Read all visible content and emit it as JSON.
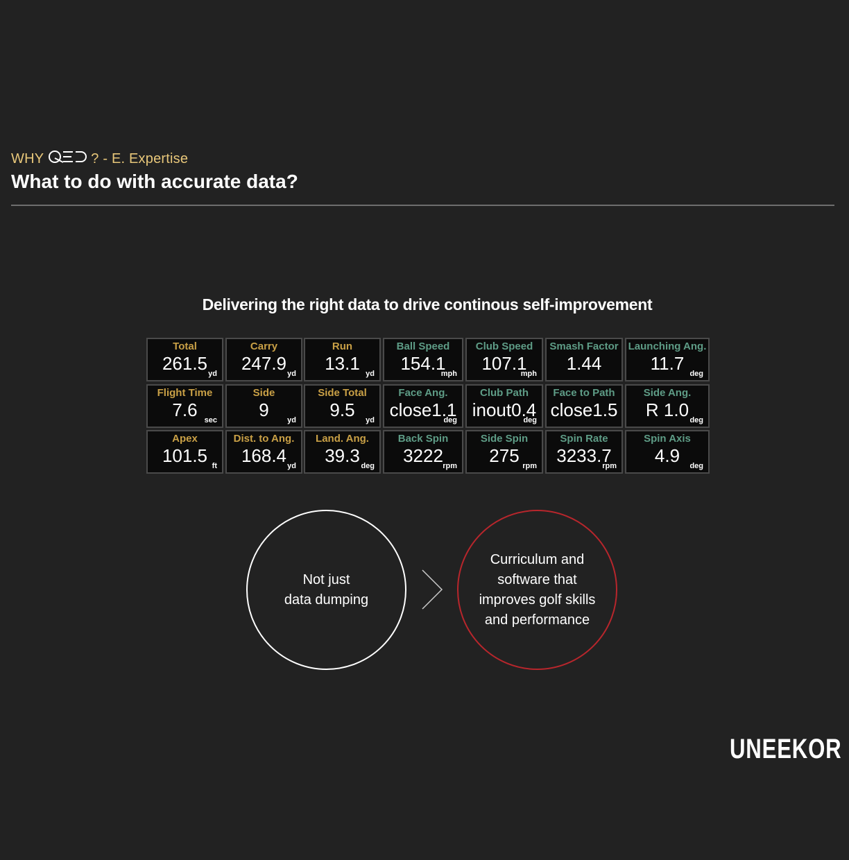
{
  "header": {
    "subtitle_prefix": "WHY",
    "subtitle_logo": "qed-logo",
    "subtitle_suffix": "? - E. Expertise",
    "title": "What to do with accurate data?"
  },
  "tagline": "Delivering the right data to drive continous self-improvement",
  "colors": {
    "background": "#222222",
    "gold_label": "#c9a046",
    "teal_label": "#5e9c86",
    "accent_red": "#b8262c"
  },
  "metrics": [
    [
      {
        "label": "Total",
        "value": "261.5",
        "unit": "yd",
        "color": "gold"
      },
      {
        "label": "Carry",
        "value": "247.9",
        "unit": "yd",
        "color": "gold"
      },
      {
        "label": "Run",
        "value": "13.1",
        "unit": "yd",
        "color": "gold"
      },
      {
        "label": "Ball Speed",
        "value": "154.1",
        "unit": "mph",
        "color": "teal"
      },
      {
        "label": "Club Speed",
        "value": "107.1",
        "unit": "mph",
        "color": "teal"
      },
      {
        "label": "Smash Factor",
        "value": "1.44",
        "unit": "",
        "color": "teal"
      },
      {
        "label": "Launching Ang.",
        "value": "11.7",
        "unit": "deg",
        "color": "teal"
      }
    ],
    [
      {
        "label": "Flight Time",
        "value": "7.6",
        "unit": "sec",
        "color": "gold"
      },
      {
        "label": "Side",
        "value": "9",
        "unit": "yd",
        "color": "gold"
      },
      {
        "label": "Side Total",
        "value": "9.5",
        "unit": "yd",
        "color": "gold"
      },
      {
        "label": "Face Ang.",
        "value": "close1.1",
        "unit": "deg",
        "color": "teal"
      },
      {
        "label": "Club Path",
        "value": "inout0.4",
        "unit": "deg",
        "color": "teal"
      },
      {
        "label": "Face to Path",
        "value": "close1.5",
        "unit": "",
        "color": "teal"
      },
      {
        "label": "Side Ang.",
        "value": "R 1.0",
        "unit": "deg",
        "color": "teal"
      }
    ],
    [
      {
        "label": "Apex",
        "value": "101.5",
        "unit": "ft",
        "color": "gold"
      },
      {
        "label": "Dist. to Ang.",
        "value": "168.4",
        "unit": "yd",
        "color": "gold"
      },
      {
        "label": "Land. Ang.",
        "value": "39.3",
        "unit": "deg",
        "color": "gold"
      },
      {
        "label": "Back Spin",
        "value": "3222",
        "unit": "rpm",
        "color": "teal"
      },
      {
        "label": "Side Spin",
        "value": "275",
        "unit": "rpm",
        "color": "teal"
      },
      {
        "label": "Spin Rate",
        "value": "3233.7",
        "unit": "rpm",
        "color": "teal"
      },
      {
        "label": "Spin Axis",
        "value": "4.9",
        "unit": "deg",
        "color": "teal"
      }
    ]
  ],
  "comparison": {
    "left_lines": [
      "Not just",
      "data dumping"
    ],
    "arrow_icon": "chevron-right-icon",
    "right_lines": [
      "Curriculum and",
      "software that",
      "improves golf skills",
      "and performance"
    ]
  },
  "brand": "UNEEKOR"
}
